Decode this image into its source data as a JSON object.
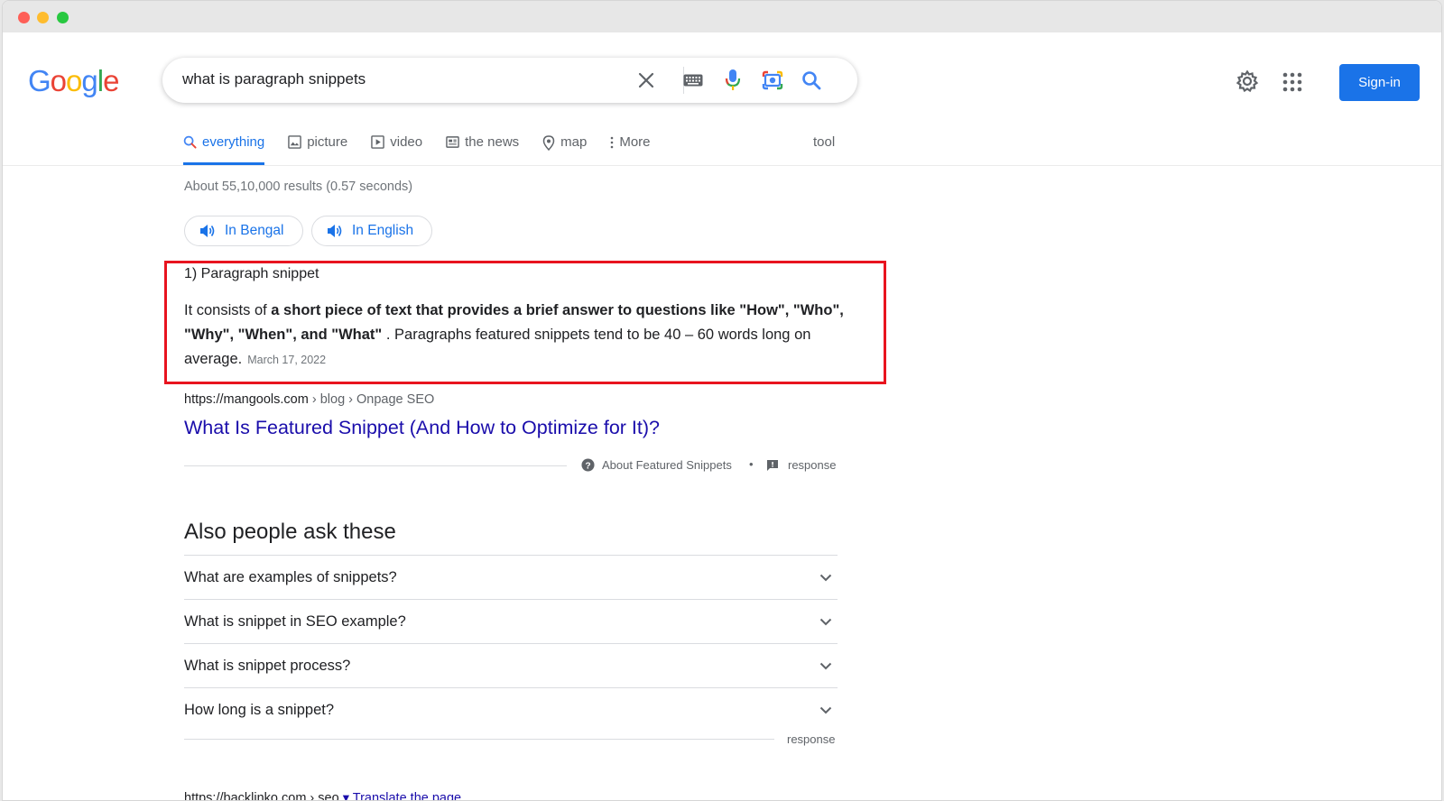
{
  "search": {
    "query": "what is paragraph snippets"
  },
  "header": {
    "sign_in_label": "Sign-in"
  },
  "logo": [
    "G",
    "o",
    "o",
    "g",
    "l",
    "e"
  ],
  "tabs": [
    {
      "label": "everything",
      "icon": "search-icon",
      "active": true
    },
    {
      "label": "picture",
      "icon": "image-icon",
      "active": false
    },
    {
      "label": "video",
      "icon": "play-icon",
      "active": false
    },
    {
      "label": "the news",
      "icon": "news-icon",
      "active": false
    },
    {
      "label": "map",
      "icon": "pin-icon",
      "active": false
    },
    {
      "label": "More",
      "icon": "more-vert-icon",
      "active": false
    }
  ],
  "tools_label": "tool",
  "stats": "About 55,10,000 results (0.57 seconds)",
  "language_buttons": [
    {
      "label": "In Bengal"
    },
    {
      "label": "In English"
    }
  ],
  "snippet": {
    "heading": "1) Paragraph snippet",
    "prefix": "It consists of ",
    "bold": "a short piece of text that provides a brief answer to questions like \"How\", \"Who\", \"Why\", \"When\", and \"What\"",
    "suffix": " . Paragraphs featured snippets tend to be 40 – 60 words long on average.",
    "date": "March 17, 2022"
  },
  "result": {
    "url_domain": "https://mangools.com",
    "url_path": " › blog › Onpage SEO",
    "title": "What Is Featured Snippet (And How to Optimize for It)?"
  },
  "featured_footer": {
    "about_label": "About Featured Snippets",
    "separator": "•",
    "feedback_label": "response"
  },
  "people_also_ask": {
    "heading": "Also people ask these",
    "questions": [
      "What are examples of snippets?",
      "What is snippet in SEO example?",
      "What is snippet process?",
      "How long is a snippet?"
    ],
    "feedback_label": "response"
  },
  "next_result": {
    "url": "https://backlinko.com › seo",
    "translate": "▾ Translate the page"
  },
  "colors": {
    "accent": "#1a73e8",
    "link": "#1a0dab",
    "highlight": "#e8141f"
  }
}
